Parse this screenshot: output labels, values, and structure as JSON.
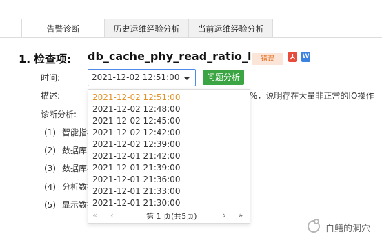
{
  "tabs": [
    {
      "label": "告警诊断",
      "active": true
    },
    {
      "label": "历史运维经验分析",
      "active": false
    },
    {
      "label": "当前运维经验分析",
      "active": false
    }
  ],
  "section": {
    "number": "1.",
    "label": "检查项:",
    "metric": "db_cache_phy_read_ratio_low",
    "badge": "错误",
    "pdf_icon": "pdf-icon",
    "word_icon": "word-icon",
    "word_glyph": "W"
  },
  "time_row": {
    "label": "时间:",
    "selected": "2021-12-02 12:51:00",
    "button": "问题分析"
  },
  "desc_row": {
    "label": "描述:",
    "tail": "%，说明存在大量非正常的IO操作"
  },
  "diag_row": {
    "label": "诊断分析:"
  },
  "steps": [
    {
      "num": "(1)",
      "text": "智能指标"
    },
    {
      "num": "(2)",
      "text": "数据库IO"
    },
    {
      "num": "(3)",
      "text": "数据库核"
    },
    {
      "num": "(4)",
      "text": "分析数据"
    },
    {
      "num": "(5)",
      "text": "显示数据"
    }
  ],
  "dropdown": {
    "options": [
      "2021-12-02 12:51:00",
      "2021-12-02 12:48:00",
      "2021-12-02 12:45:00",
      "2021-12-02 12:42:00",
      "2021-12-02 12:39:00",
      "2021-12-01 21:42:00",
      "2021-12-01 21:39:00",
      "2021-12-01 21:36:00",
      "2021-12-01 21:33:00",
      "2021-12-01 21:30:00"
    ],
    "selected_index": 0,
    "pager": {
      "first": "«",
      "prev": "‹",
      "text": "第 1 页(共5页)",
      "next": "›",
      "last": "»"
    }
  },
  "watermark": {
    "text": "白鳝的洞穴"
  },
  "colors": {
    "accent_blue": "#4b8be6",
    "green_button": "#3ba543",
    "selected_orange": "#e4932a",
    "badge_text": "#e4711f"
  }
}
